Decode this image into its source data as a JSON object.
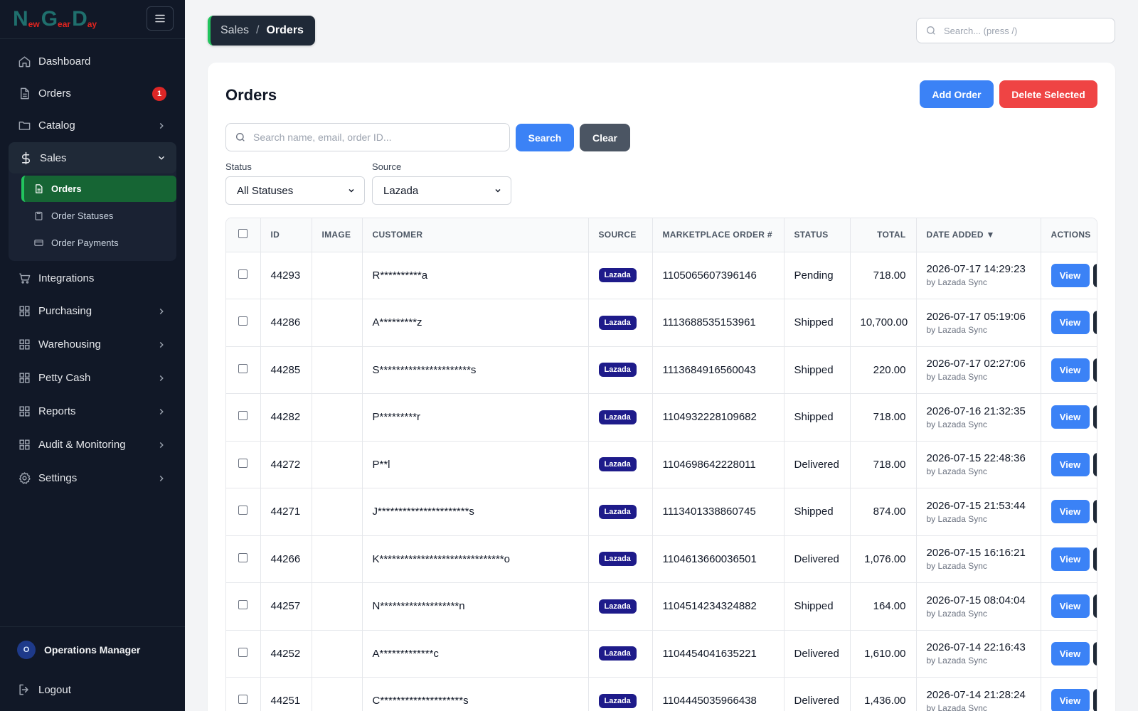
{
  "brand": {
    "letters": [
      {
        "big": "N",
        "small": "ew"
      },
      {
        "big": "G",
        "small": "ear"
      },
      {
        "big": "D",
        "small": "ay"
      }
    ]
  },
  "sidebar": {
    "items": [
      {
        "label": "Dashboard",
        "icon": "home-icon"
      },
      {
        "label": "Orders",
        "icon": "document-icon",
        "badge": "1"
      },
      {
        "label": "Catalog",
        "icon": "folder-icon"
      },
      {
        "label": "Sales",
        "icon": "dollar-icon"
      },
      {
        "label": "Integrations",
        "icon": "cart-icon"
      },
      {
        "label": "Purchasing",
        "icon": "grid-icon"
      },
      {
        "label": "Warehousing",
        "icon": "grid-icon"
      },
      {
        "label": "Petty Cash",
        "icon": "grid-icon"
      },
      {
        "label": "Reports",
        "icon": "grid-icon"
      },
      {
        "label": "Audit & Monitoring",
        "icon": "grid-icon"
      },
      {
        "label": "Settings",
        "icon": "gear-icon"
      }
    ],
    "sales_sub": [
      {
        "label": "Orders",
        "icon": "document-icon"
      },
      {
        "label": "Order Statuses",
        "icon": "clipboard-icon"
      },
      {
        "label": "Order Payments",
        "icon": "credit-card-icon"
      }
    ],
    "user": {
      "initial": "O",
      "name": "Operations Manager"
    },
    "logout": "Logout"
  },
  "breadcrumb": {
    "parent": "Sales",
    "separator": "/",
    "current": "Orders"
  },
  "global_search": {
    "placeholder": "Search... (press /)"
  },
  "main": {
    "title": "Orders",
    "add_button": "Add Order",
    "delete_button": "Delete Selected",
    "search_placeholder": "Search name, email, order ID...",
    "search_button": "Search",
    "clear_button": "Clear",
    "filters": {
      "status_label": "Status",
      "status_value": "All Statuses",
      "source_label": "Source",
      "source_value": "Lazada"
    }
  },
  "table": {
    "headers": [
      "ID",
      "IMAGE",
      "CUSTOMER",
      "SOURCE",
      "MARKETPLACE ORDER #",
      "STATUS",
      "TOTAL",
      "DATE ADDED ▼",
      "ACTIONS"
    ],
    "view_label": "View",
    "rows": [
      {
        "id": "44293",
        "customer": "R**********a",
        "source": "Lazada",
        "mp": "1105065607396146",
        "status": "Pending",
        "total": "718.00",
        "date": "2026-07-17 14:29:23",
        "by": "by Lazada Sync"
      },
      {
        "id": "44286",
        "customer": "A*********z",
        "source": "Lazada",
        "mp": "1113688535153961",
        "status": "Shipped",
        "total": "10,700.00",
        "date": "2026-07-17 05:19:06",
        "by": "by Lazada Sync"
      },
      {
        "id": "44285",
        "customer": "S**********************s",
        "source": "Lazada",
        "mp": "1113684916560043",
        "status": "Shipped",
        "total": "220.00",
        "date": "2026-07-17 02:27:06",
        "by": "by Lazada Sync"
      },
      {
        "id": "44282",
        "customer": "P*********r",
        "source": "Lazada",
        "mp": "1104932228109682",
        "status": "Shipped",
        "total": "718.00",
        "date": "2026-07-16 21:32:35",
        "by": "by Lazada Sync"
      },
      {
        "id": "44272",
        "customer": "P**l",
        "source": "Lazada",
        "mp": "1104698642228011",
        "status": "Delivered",
        "total": "718.00",
        "date": "2026-07-15 22:48:36",
        "by": "by Lazada Sync"
      },
      {
        "id": "44271",
        "customer": "J**********************s",
        "source": "Lazada",
        "mp": "1113401338860745",
        "status": "Shipped",
        "total": "874.00",
        "date": "2026-07-15 21:53:44",
        "by": "by Lazada Sync"
      },
      {
        "id": "44266",
        "customer": "K******************************o",
        "source": "Lazada",
        "mp": "1104613660036501",
        "status": "Delivered",
        "total": "1,076.00",
        "date": "2026-07-15 16:16:21",
        "by": "by Lazada Sync"
      },
      {
        "id": "44257",
        "customer": "N*******************n",
        "source": "Lazada",
        "mp": "1104514234324882",
        "status": "Shipped",
        "total": "164.00",
        "date": "2026-07-15 08:04:04",
        "by": "by Lazada Sync"
      },
      {
        "id": "44252",
        "customer": "A*************c",
        "source": "Lazada",
        "mp": "1104454041635221",
        "status": "Delivered",
        "total": "1,610.00",
        "date": "2026-07-14 22:16:43",
        "by": "by Lazada Sync"
      },
      {
        "id": "44251",
        "customer": "C********************s",
        "source": "Lazada",
        "mp": "1104445035966438",
        "status": "Delivered",
        "total": "1,436.00",
        "date": "2026-07-14 21:28:24",
        "by": "by Lazada Sync"
      }
    ]
  }
}
